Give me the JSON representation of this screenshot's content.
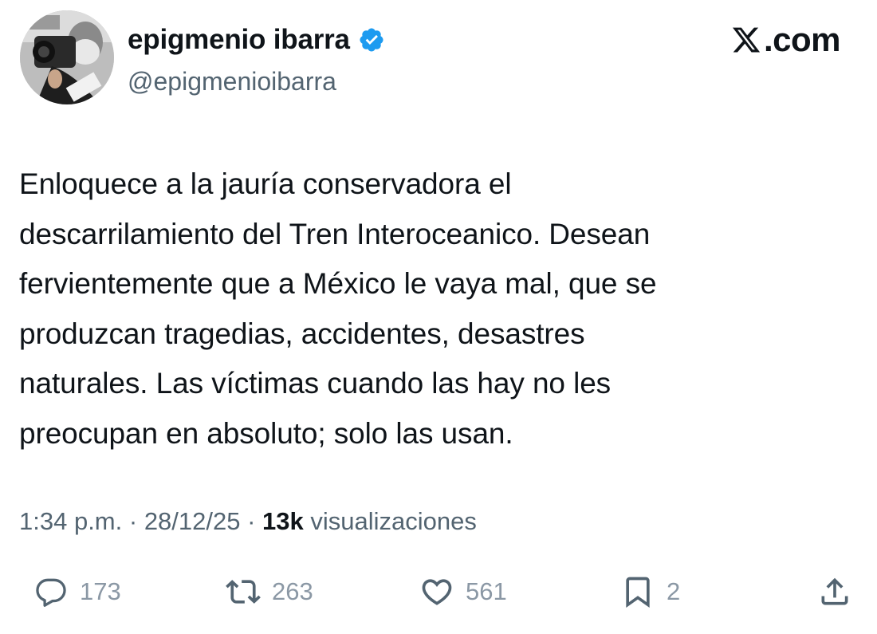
{
  "author": {
    "display_name": "epigmenio ibarra",
    "handle": "@epigmenioibarra",
    "verified": true,
    "avatar": "profile-photo"
  },
  "brand": {
    "logo": "x-logo",
    "text": ".com"
  },
  "tweet": {
    "text": "Enloquece a la jauría conservadora el\ndescarrilamiento del Tren Interoceanico. Desean\nfervientemente que a México le vaya mal, que se\nproduzcan tragedias, accidentes, desastres\nnaturales. Las víctimas cuando las hay no les\npreocupan en absoluto; solo las usan."
  },
  "meta": {
    "time": "1:34 p.m.",
    "separator": " · ",
    "date": "28/12/25",
    "views_count": "13k",
    "views_label": " visualizaciones"
  },
  "actions": {
    "replies": "173",
    "reposts": "263",
    "likes": "561",
    "bookmarks": "2"
  },
  "colors": {
    "text_primary": "#0f1419",
    "text_secondary": "#536471",
    "verified_blue": "#1d9bf0"
  }
}
